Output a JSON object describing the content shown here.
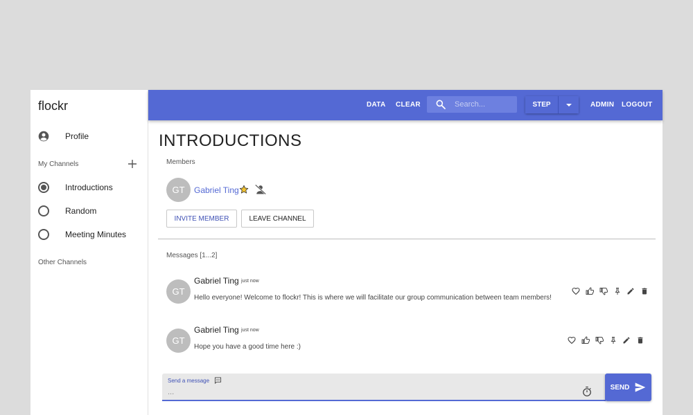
{
  "sidebar": {
    "brand": "flockr",
    "profile_label": "Profile",
    "my_channels_label": "My Channels",
    "channels": [
      {
        "label": "Introductions",
        "selected": true
      },
      {
        "label": "Random",
        "selected": false
      },
      {
        "label": "Meeting Minutes",
        "selected": false
      }
    ],
    "other_channels_label": "Other Channels"
  },
  "topbar": {
    "data_label": "DATA",
    "clear_label": "CLEAR",
    "search_placeholder": "Search...",
    "step_label": "STEP",
    "admin_label": "ADMIN",
    "logout_label": "LOGOUT",
    "color": "#5469d4"
  },
  "channel": {
    "title": "INTRODUCTIONS",
    "members_label": "Members",
    "members": [
      {
        "initials": "GT",
        "name": "Gabriel Ting",
        "owner": true
      }
    ],
    "invite_label": "INVITE MEMBER",
    "leave_label": "LEAVE CHANNEL",
    "messages_label": "Messages [1...2]",
    "messages": [
      {
        "initials": "GT",
        "author": "Gabriel Ting",
        "time": "just now",
        "text": "Hello everyone! Welcome to flockr! This is where we will facilitate our group communication between team members!"
      },
      {
        "initials": "GT",
        "author": "Gabriel Ting",
        "time": "just now",
        "text": "Hope you have a good time here :)"
      }
    ]
  },
  "composer": {
    "label": "Send a message",
    "input_value": "",
    "placeholder": "...",
    "send_label": "SEND"
  },
  "icons": {
    "profile": "account-circle-icon",
    "add": "plus-icon",
    "search": "search-icon",
    "dropdown": "caret-down-icon",
    "owner": "star-icon",
    "remove_owner": "person-off-icon",
    "react": "heart-outline-icon",
    "like": "thumb-up-icon",
    "dislike": "thumb-down-icon",
    "pin": "pin-icon",
    "edit": "pencil-icon",
    "delete": "trash-icon",
    "chat": "chat-bubble-icon",
    "timer": "timer-icon",
    "send": "send-icon"
  }
}
